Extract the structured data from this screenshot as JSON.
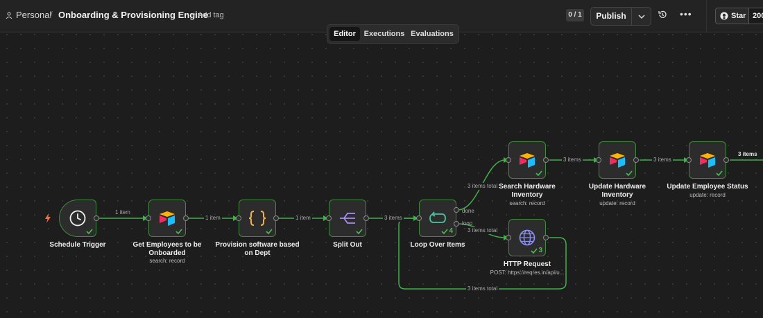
{
  "header": {
    "breadcrumb_owner": "Personal",
    "workflow_title": "Onboarding & Provisioning Engine",
    "add_tag_label": "+ Add tag",
    "counter": "0 / 1",
    "publish_label": "Publish",
    "github_star_label": "Star",
    "github_star_count": "200"
  },
  "tabs": [
    "Editor",
    "Executions",
    "Evaluations"
  ],
  "active_tab": "Editor",
  "nodes": {
    "schedule": {
      "label": "Schedule Trigger"
    },
    "get_employees": {
      "label_line1": "Get Employees to be",
      "label_line2": "Onboarded",
      "sub": "search: record"
    },
    "provision": {
      "label_line1": "Provision software based",
      "label_line2": "on Dept"
    },
    "split": {
      "label": "Split Out"
    },
    "loop": {
      "label": "Loop Over Items",
      "badge": "4",
      "done_port": "done",
      "loop_port": "loop"
    },
    "search_hw": {
      "label_line1": "Search Hardware",
      "label_line2": "Inventory",
      "sub": "search: record"
    },
    "update_hw": {
      "label_line1": "Update Hardware",
      "label_line2": "Inventory",
      "sub": "update: record"
    },
    "update_status": {
      "label": "Update Employee Status",
      "sub": "update: record"
    },
    "http": {
      "label": "HTTP Request",
      "sub": "POST: https://reqres.in/api/u...",
      "badge": "3"
    }
  },
  "edges": {
    "e1": "1 item",
    "e2": "1 item",
    "e3": "1 item",
    "e4": "3 items",
    "e5": "3 items total",
    "e6": "3 items",
    "e7": "3 items",
    "e8": "3 items",
    "e9": "3 items total",
    "e10": "3 items total"
  },
  "colors": {
    "edge_success": "#3fb24a",
    "node_border": "#3f8a3f",
    "trigger_bolt": "#ff6d3a"
  }
}
